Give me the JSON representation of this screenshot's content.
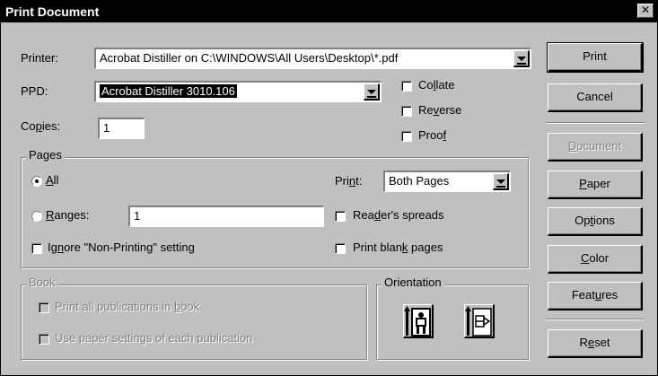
{
  "window": {
    "title": "Print Document",
    "close_glyph": "✕"
  },
  "printer": {
    "label": "Printer:",
    "value": "Acrobat Distiller on C:\\WINDOWS\\All Users\\Desktop\\*.pdf"
  },
  "ppd": {
    "label": "PPD:",
    "value": "Acrobat Distiller 3010.106"
  },
  "copies": {
    "label": "Copies:",
    "value": "1"
  },
  "options": {
    "collate": {
      "label": "Collate",
      "checked": false
    },
    "reverse": {
      "label": "Reverse",
      "checked": false
    },
    "proof": {
      "label": "Proof",
      "checked": false
    }
  },
  "pages": {
    "group_title": "Pages",
    "all_label": "All",
    "ranges_label": "Ranges:",
    "ranges_value": "1",
    "ignore_nonprinting_label": "Ignore \"Non-Printing\" setting",
    "print_label": "Print:",
    "print_value": "Both Pages",
    "readers_spreads_label": "Reader's spreads",
    "print_blank_label": "Print blank pages",
    "selected": "all"
  },
  "book": {
    "group_title": "Book",
    "print_all_label": "Print all publications in book",
    "use_paper_label": "Use paper settings of each publication"
  },
  "orientation": {
    "group_title": "Orientation",
    "selected": "portrait",
    "options": [
      "portrait",
      "landscape"
    ]
  },
  "buttons": {
    "print": "Print",
    "cancel": "Cancel",
    "document": "Document",
    "paper": "Paper",
    "options": "Options",
    "color": "Color",
    "features": "Features",
    "reset": "Reset"
  },
  "icons": {
    "close": "close-icon",
    "portrait": "portrait-orientation-icon",
    "landscape": "landscape-orientation-icon",
    "dropdown": "chevron-down-icon"
  }
}
